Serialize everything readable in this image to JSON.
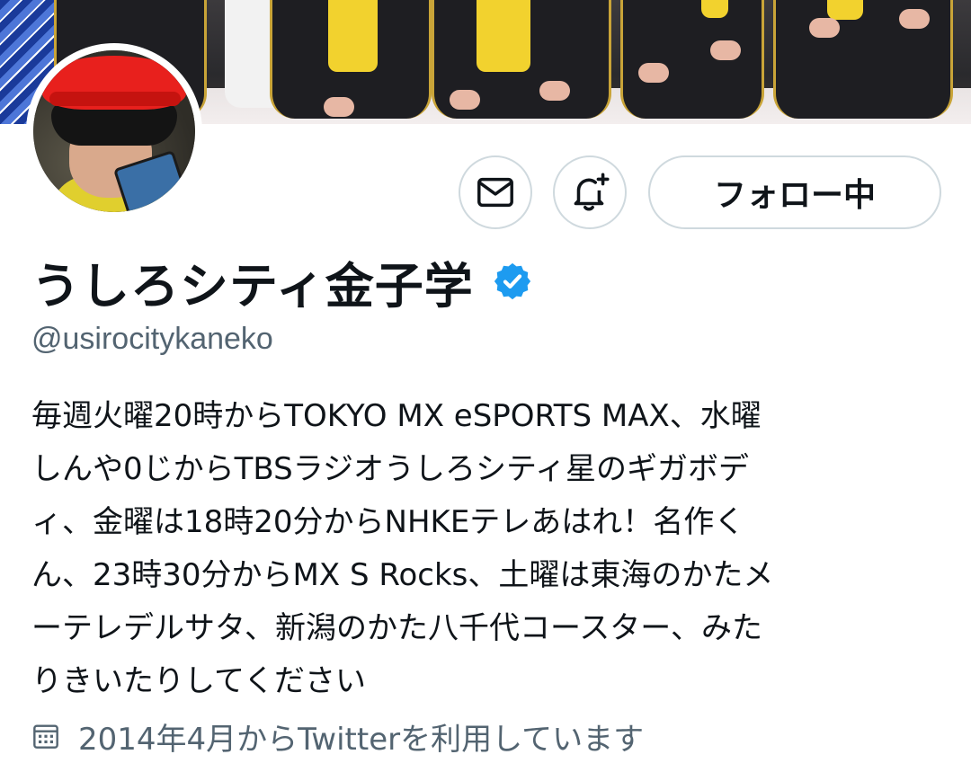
{
  "profile": {
    "display_name": "うしろシティ金子学",
    "handle": "@usirocitykaneko",
    "verified": true,
    "bio": "毎週火曜20時からTOKYO MX eSPORTS MAX、水曜\nしんや0じからTBSラジオうしろシティ星のギガボデ\nィ、金曜は18時20分からNHKEテレあはれ！名作く\nん、23時30分からMX S Rocks、土曜は東海のかたメ\nーテレデルサタ、新潟のかた八千代コースター、みた\nりきいたりしてください",
    "joined": "2014年4月からTwitterを利用しています"
  },
  "actions": {
    "message_icon": "envelope-icon",
    "notify_icon": "bell-plus-icon",
    "follow_label": "フォロー中"
  },
  "icons": {
    "verified": "verified-badge-icon",
    "calendar": "calendar-icon"
  },
  "colors": {
    "verified_blue": "#1d9bf0",
    "text_primary": "#0f1419",
    "text_secondary": "#536471",
    "border": "#cfd9de"
  }
}
